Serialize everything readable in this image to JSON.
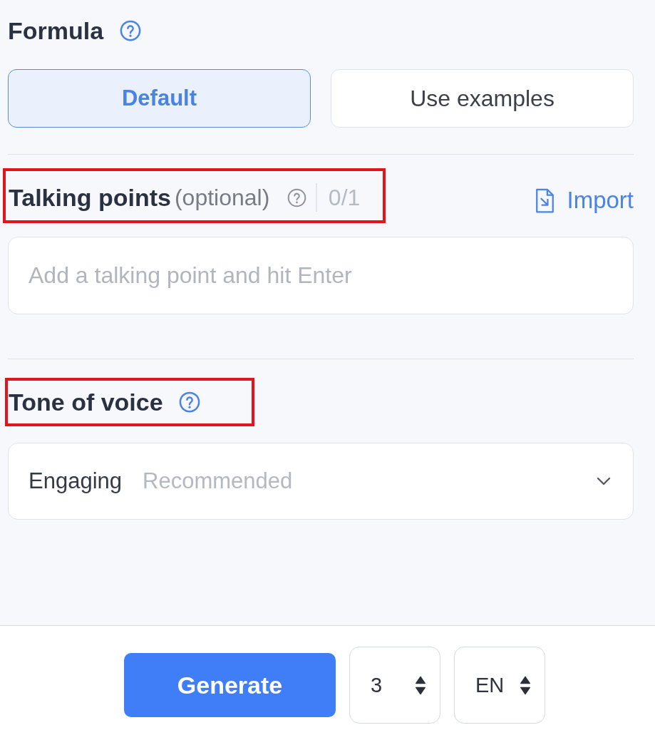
{
  "formula": {
    "title": "Formula",
    "options": [
      {
        "label": "Default",
        "selected": true
      },
      {
        "label": "Use examples",
        "selected": false
      }
    ]
  },
  "talking_points": {
    "title": "Talking points",
    "note": "(optional)",
    "counter": "0/1",
    "highlighted": true,
    "import_label": "Import",
    "input": {
      "placeholder": "Add a talking point and hit Enter"
    }
  },
  "tone_of_voice": {
    "title": "Tone of voice",
    "highlighted": true,
    "select": {
      "value": "Engaging",
      "hint": "Recommended"
    }
  },
  "footer": {
    "generate_label": "Generate",
    "count": {
      "value": "3"
    },
    "language": {
      "value": "EN"
    }
  }
}
